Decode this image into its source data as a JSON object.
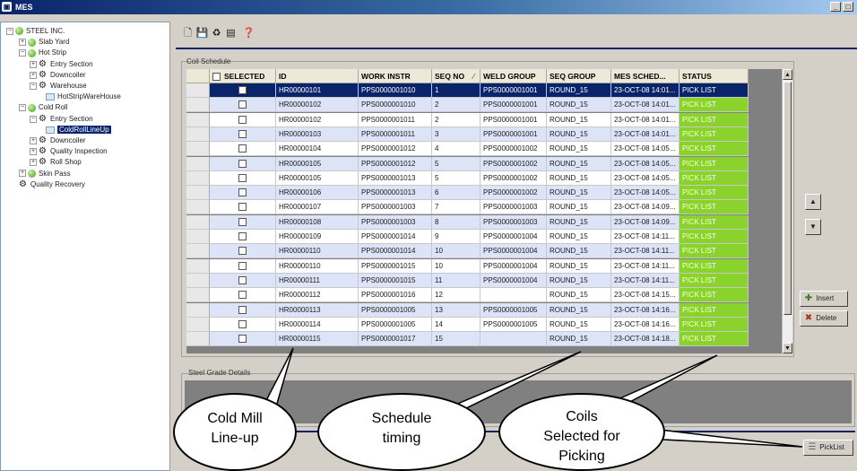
{
  "window": {
    "title": "MES",
    "controls": [
      "_",
      "□",
      "✕"
    ]
  },
  "tree": {
    "nodes": [
      {
        "label": "STEEL INC.",
        "icon": "globe-icon",
        "expander": "−"
      },
      {
        "label": "Slab Yard",
        "icon": "globe-icon",
        "expander": "+"
      },
      {
        "label": "Hot Strip",
        "icon": "globe-icon",
        "expander": "−"
      },
      {
        "label": "Entry Section",
        "icon": "gear-icon",
        "expander": "+"
      },
      {
        "label": "Downcoiler",
        "icon": "gear-icon",
        "expander": "+"
      },
      {
        "label": "Warehouse",
        "icon": "gear-icon",
        "expander": "−"
      },
      {
        "label": "HotStripWareHouse",
        "icon": "warehouse-icon",
        "expander": ""
      },
      {
        "label": "Cold Roll",
        "icon": "globe-icon",
        "expander": "−"
      },
      {
        "label": "Entry Section",
        "icon": "gear-icon",
        "expander": "−"
      },
      {
        "label": "ColdRollLineUp",
        "icon": "lineup-icon",
        "expander": "",
        "selected": true
      },
      {
        "label": "Downcoiler",
        "icon": "gear-icon",
        "expander": "+"
      },
      {
        "label": "Quality Inspection",
        "icon": "gear-icon",
        "expander": "+"
      },
      {
        "label": "Roll Shop",
        "icon": "gear-icon",
        "expander": "+"
      },
      {
        "label": "Skin Pass",
        "icon": "globe-icon",
        "expander": "+"
      },
      {
        "label": "Quality Recovery",
        "icon": "gear-icon",
        "expander": ""
      }
    ]
  },
  "toolbar": {
    "buttons": [
      "new-icon",
      "save-icon",
      "refresh-icon",
      "export-icon",
      "help-icon"
    ]
  },
  "coil_schedule": {
    "group_label": "Coil Schedule",
    "columns": [
      "SELECTED",
      "ID",
      "WORK INSTR",
      "SEQ NO",
      "WELD GROUP",
      "SEQ GROUP",
      "MES SCHED...",
      "STATUS"
    ],
    "sort_indicator": "⁄",
    "rows": [
      {
        "id": "HR00000101",
        "work": "PPS0000001010",
        "seq": "1",
        "weld": "PPS0000001001",
        "seqgrp": "ROUND_15",
        "sched": "23-OCT-08 14:01...",
        "status": "PICK LIST"
      },
      {
        "id": "HR00000102",
        "work": "PPS0000001010",
        "seq": "2",
        "weld": "PPS0000001001",
        "seqgrp": "ROUND_15",
        "sched": "23-OCT-08 14:01...",
        "status": "PICK LIST"
      },
      {
        "id": "HR00000102",
        "work": "PPS0000001011",
        "seq": "2",
        "weld": "PPS0000001001",
        "seqgrp": "ROUND_15",
        "sched": "23-OCT-08 14:01...",
        "status": "PICK LIST"
      },
      {
        "id": "HR00000103",
        "work": "PPS0000001011",
        "seq": "3",
        "weld": "PPS0000001001",
        "seqgrp": "ROUND_15",
        "sched": "23-OCT-08 14:01...",
        "status": "PICK LIST"
      },
      {
        "id": "HR00000104",
        "work": "PPS0000001012",
        "seq": "4",
        "weld": "PPS0000001002",
        "seqgrp": "ROUND_15",
        "sched": "23-OCT-08 14:05...",
        "status": "PICK LIST"
      },
      {
        "id": "HR00000105",
        "work": "PPS0000001012",
        "seq": "5",
        "weld": "PPS0000001002",
        "seqgrp": "ROUND_15",
        "sched": "23-OCT-08 14:05...",
        "status": "PICK LIST"
      },
      {
        "id": "HR00000105",
        "work": "PPS0000001013",
        "seq": "5",
        "weld": "PPS0000001002",
        "seqgrp": "ROUND_15",
        "sched": "23-OCT-08 14:05...",
        "status": "PICK LIST"
      },
      {
        "id": "HR00000106",
        "work": "PPS0000001013",
        "seq": "6",
        "weld": "PPS0000001002",
        "seqgrp": "ROUND_15",
        "sched": "23-OCT-08 14:05...",
        "status": "PICK LIST"
      },
      {
        "id": "HR00000107",
        "work": "PPS0000001003",
        "seq": "7",
        "weld": "PPS0000001003",
        "seqgrp": "ROUND_15",
        "sched": "23-OCT-08 14:09...",
        "status": "PICK LIST"
      },
      {
        "id": "HR00000108",
        "work": "PPS0000001003",
        "seq": "8",
        "weld": "PPS0000001003",
        "seqgrp": "ROUND_15",
        "sched": "23-OCT-08 14:09...",
        "status": "PICK LIST"
      },
      {
        "id": "HR00000109",
        "work": "PPS0000001014",
        "seq": "9",
        "weld": "PPS0000001004",
        "seqgrp": "ROUND_15",
        "sched": "23-OCT-08 14:11...",
        "status": "PICK LIST"
      },
      {
        "id": "HR00000110",
        "work": "PPS0000001014",
        "seq": "10",
        "weld": "PPS0000001004",
        "seqgrp": "ROUND_15",
        "sched": "23-OCT-08 14:11...",
        "status": "PICK LIST"
      },
      {
        "id": "HR00000110",
        "work": "PPS0000001015",
        "seq": "10",
        "weld": "PPS0000001004",
        "seqgrp": "ROUND_15",
        "sched": "23-OCT-08 14:11...",
        "status": "PICK LIST"
      },
      {
        "id": "HR00000111",
        "work": "PPS0000001015",
        "seq": "11",
        "weld": "PPS0000001004",
        "seqgrp": "ROUND_15",
        "sched": "23-OCT-08 14:11...",
        "status": "PICK LIST"
      },
      {
        "id": "HR00000112",
        "work": "PPS0000001016",
        "seq": "12",
        "weld": "",
        "seqgrp": "ROUND_15",
        "sched": "23-OCT-08 14:15...",
        "status": "PICK LIST"
      },
      {
        "id": "HR00000113",
        "work": "PPS0000001005",
        "seq": "13",
        "weld": "PPS0000001005",
        "seqgrp": "ROUND_15",
        "sched": "23-OCT-08 14:16...",
        "status": "PICK LIST"
      },
      {
        "id": "HR00000114",
        "work": "PPS0000001005",
        "seq": "14",
        "weld": "PPS0000001005",
        "seqgrp": "ROUND_15",
        "sched": "23-OCT-08 14:16...",
        "status": "PICK LIST"
      },
      {
        "id": "HR00000115",
        "work": "PPS0000001017",
        "seq": "15",
        "weld": "",
        "seqgrp": "ROUND_15",
        "sched": "23-OCT-08 14:18...",
        "status": "PICK LIST"
      }
    ]
  },
  "side_buttons": {
    "move_up": "▲",
    "move_down": "▼",
    "insert": "Insert",
    "delete": "Delete",
    "picklist": "PickList"
  },
  "steel_grade": {
    "label": "Steel Grade Details"
  },
  "callouts": {
    "cold_mill": [
      "Cold Mill",
      "Line-up"
    ],
    "schedule": [
      "Schedule",
      "timing"
    ],
    "coils": [
      "Coils",
      "Selected for",
      "Picking"
    ]
  },
  "colors": {
    "status_green": "#8ad22c",
    "selection_navy": "#0a246a",
    "alt_row": "#dde4f8"
  }
}
